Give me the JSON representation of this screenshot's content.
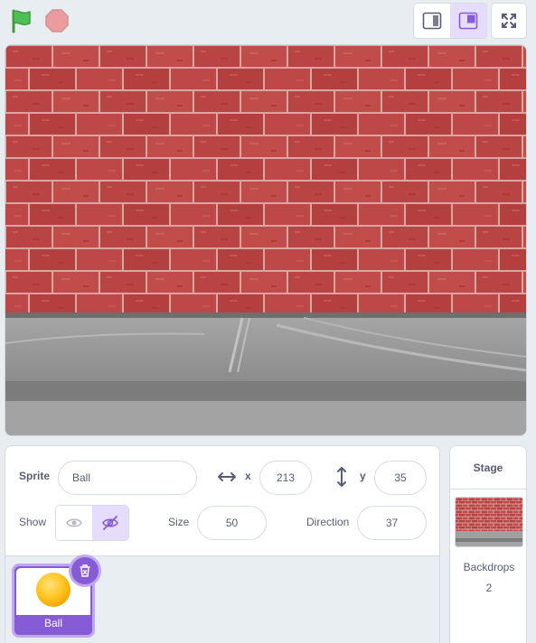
{
  "toolbar": {
    "green_flag_icon": "green-flag-icon",
    "stop_icon": "stop-sign-icon",
    "small_stage_icon": "small-stage-layout-icon",
    "normal_stage_icon": "normal-stage-layout-icon",
    "fullscreen_icon": "fullscreen-icon",
    "active_mode": "normal"
  },
  "stage": {
    "backdrop": "brick-wall",
    "wall_color": "#b94a48",
    "ground_color": "#9a9a9a"
  },
  "sprite_info": {
    "sprite_label": "Sprite",
    "sprite_name": "Ball",
    "x_label": "x",
    "x_value": "213",
    "y_label": "y",
    "y_value": "35",
    "show_label": "Show",
    "visible": false,
    "size_label": "Size",
    "size_value": "50",
    "direction_label": "Direction",
    "direction_value": "37"
  },
  "sprites": [
    {
      "name": "Ball",
      "selected": true
    }
  ],
  "stage_panel": {
    "title": "Stage",
    "backdrops_label": "Backdrops",
    "backdrops_count": "2"
  },
  "colors": {
    "accent": "#855cd6",
    "accent_light": "#e6dcfb",
    "text": "#575e75",
    "border": "#d5dbe3",
    "flag_green": "#4cbf56",
    "stop_red": "#ec5959"
  }
}
